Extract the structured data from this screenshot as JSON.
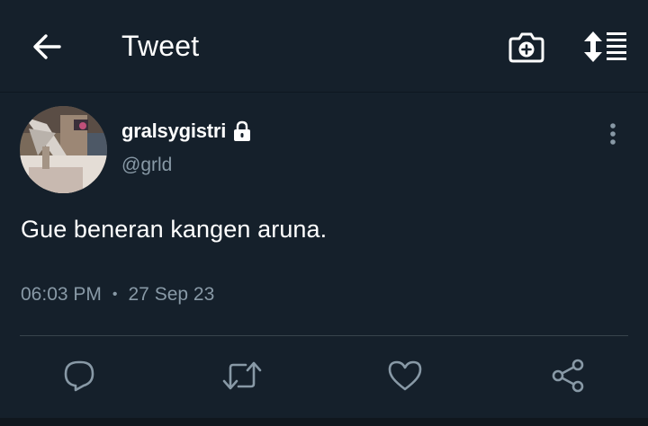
{
  "header": {
    "title": "Tweet",
    "back_icon": "arrow-left-icon",
    "camera_icon": "camera-plus-icon",
    "sort_icon": "sort-list-icon"
  },
  "tweet": {
    "display_name": "gralsygistri",
    "protected_icon": "lock-icon",
    "handle": "@grld",
    "text": "Gue beneran kangen aruna.",
    "time": "06:03 PM",
    "separator": "•",
    "date": "27 Sep 23",
    "more_icon": "more-vertical-icon"
  },
  "actions": [
    {
      "name": "reply",
      "icon": "reply-icon"
    },
    {
      "name": "retweet",
      "icon": "retweet-icon"
    },
    {
      "name": "like",
      "icon": "heart-icon"
    },
    {
      "name": "share",
      "icon": "share-icon"
    }
  ],
  "colors": {
    "background": "#15202b",
    "text_primary": "#ffffff",
    "text_secondary": "#8899a6",
    "divider": "#38444d"
  }
}
